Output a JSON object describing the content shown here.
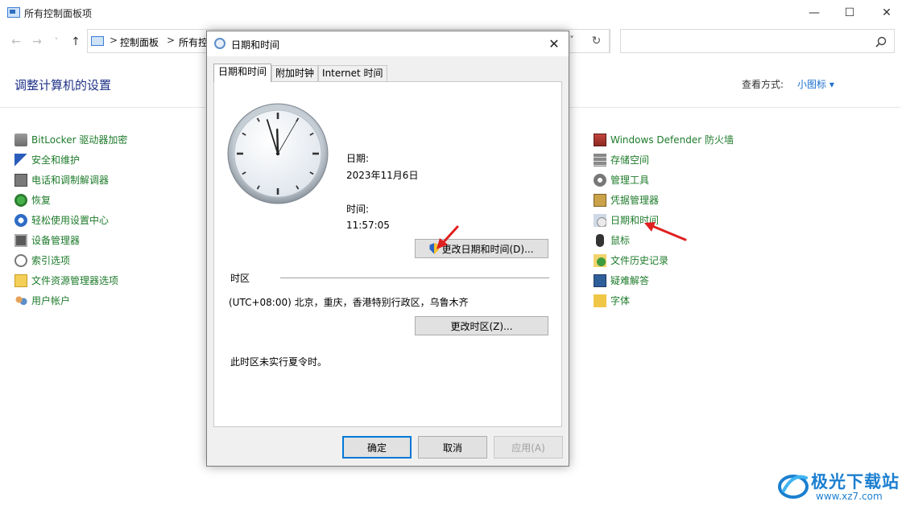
{
  "window": {
    "title": "所有控制面板项",
    "minimize": "—",
    "maximize": "☐",
    "close": "✕"
  },
  "address": {
    "crumbs": [
      "控制面板",
      "所有控"
    ],
    "separators": [
      ">",
      ">"
    ],
    "dropdown": "˅",
    "refresh": "↻",
    "search_placeholder": ""
  },
  "nav": {
    "back": "←",
    "forward": "→",
    "recent": "˅",
    "up": "↑"
  },
  "page": {
    "heading": "调整计算机的设置",
    "view_by_label": "查看方式:",
    "view_by_value": "小图标 ▾"
  },
  "left_items": [
    {
      "label": "BitLocker 驱动器加密",
      "icon": "bitlocker-icon"
    },
    {
      "label": "安全和维护",
      "icon": "flag-icon"
    },
    {
      "label": "电话和调制解调器",
      "icon": "modem-icon"
    },
    {
      "label": "恢复",
      "icon": "recovery-icon"
    },
    {
      "label": "轻松使用设置中心",
      "icon": "ease-of-access-icon"
    },
    {
      "label": "设备管理器",
      "icon": "device-manager-icon"
    },
    {
      "label": "索引选项",
      "icon": "indexing-icon"
    },
    {
      "label": "文件资源管理器选项",
      "icon": "folder-options-icon"
    },
    {
      "label": "用户帐户",
      "icon": "user-accounts-icon"
    }
  ],
  "right_items": [
    {
      "label": "Windows Defender 防火墙",
      "icon": "firewall-icon"
    },
    {
      "label": "存储空间",
      "icon": "storage-icon"
    },
    {
      "label": "管理工具",
      "icon": "admin-tools-icon"
    },
    {
      "label": "凭据管理器",
      "icon": "credential-icon"
    },
    {
      "label": "日期和时间",
      "icon": "date-time-icon"
    },
    {
      "label": "鼠标",
      "icon": "mouse-icon"
    },
    {
      "label": "文件历史记录",
      "icon": "file-history-icon"
    },
    {
      "label": "疑难解答",
      "icon": "troubleshooting-icon"
    },
    {
      "label": "字体",
      "icon": "fonts-icon"
    }
  ],
  "dialog": {
    "title": "日期和时间",
    "close": "✕",
    "tabs": [
      "日期和时间",
      "附加时钟",
      "Internet 时间"
    ],
    "date_label": "日期:",
    "date_value": "2023年11月6日",
    "time_label": "时间:",
    "time_value": "11:57:05",
    "change_datetime_button": "更改日期和时间(D)...",
    "timezone_section": "时区",
    "timezone_value": "(UTC+08:00) 北京，重庆，香港特别行政区，乌鲁木齐",
    "change_timezone_button": "更改时区(Z)...",
    "dst_note": "此时区未实行夏令时。",
    "ok": "确定",
    "cancel": "取消",
    "apply": "应用(A)"
  },
  "clock": {
    "hour": 11,
    "minute": 57,
    "second": 5
  },
  "watermark": {
    "text": "极光下载站",
    "url": "www.xz7.com"
  },
  "colors": {
    "link_green": "#1e7b2b",
    "heading_blue": "#1e3287",
    "accent_blue": "#0078d7",
    "annotation_red": "#e02020"
  }
}
